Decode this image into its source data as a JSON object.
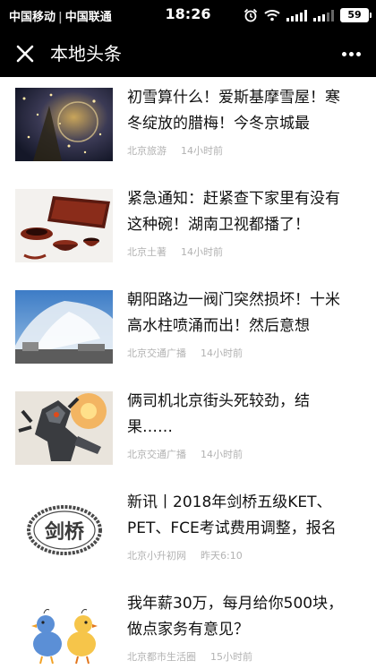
{
  "status_bar": {
    "carrier1": "中国移动",
    "carrier2": "中国联通",
    "time": "18:26",
    "battery": "59",
    "icons": [
      "alarm-icon",
      "wifi-icon",
      "signal-icon",
      "signal-icon",
      "battery-icon"
    ]
  },
  "nav": {
    "title": "本地头条",
    "close_icon": "close-icon",
    "more_icon": "more-dots-icon"
  },
  "feed": {
    "items": [
      {
        "title": "初雪算什么！爱斯基摩雪屋！寒冬绽放的腊梅！今冬京城最",
        "source": "北京旅游",
        "time": "14小时前",
        "thumb_icon": "snow-night-photo"
      },
      {
        "title": "紧急通知：赶紧查下家里有没有这种碗！湖南卫视都播了！",
        "source": "北京土著",
        "time": "14小时前",
        "thumb_icon": "lacquer-bowls-photo"
      },
      {
        "title": "朝阳路边一阀门突然损坏！十米高水柱喷涌而出！然后意想",
        "source": "北京交通广播",
        "time": "14小时前",
        "thumb_icon": "water-column-photo"
      },
      {
        "title": "俩司机北京街头死较劲，结果……",
        "source": "北京交通广播",
        "time": "14小时前",
        "thumb_icon": "robot-photo"
      },
      {
        "title": "新讯丨2018年剑桥五级KET、PET、FCE考试费用调整，报名",
        "source": "北京小升初网",
        "time": "昨天6:10",
        "thumb_icon": "cambridge-stamp",
        "thumb_text": "剑桥"
      },
      {
        "title": "我年薪30万，每月给你500块，做点家务有意见？",
        "source": "北京都市生活圈",
        "time": "15小时前",
        "thumb_icon": "cartoon-chicks"
      }
    ]
  },
  "colors": {
    "bar": "#000000",
    "meta": "#b2b2b2",
    "text": "#111111"
  }
}
